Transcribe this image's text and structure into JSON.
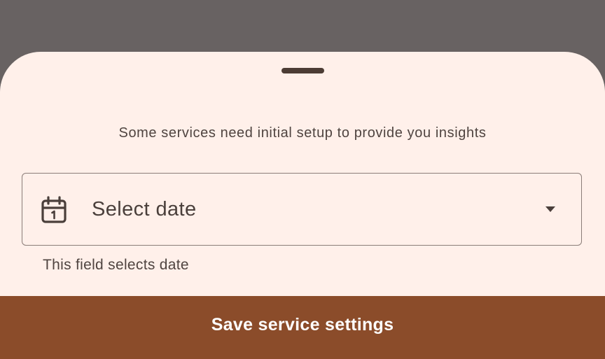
{
  "sheet": {
    "subtitle": "Some services need initial setup to provide you insights",
    "date_field": {
      "icon": "calendar-icon",
      "value": "Select date",
      "trailing_icon": "dropdown-arrow-icon",
      "helper_text": "This field selects date"
    },
    "save_button_label": "Save service settings"
  },
  "colors": {
    "scrim": "#686262",
    "sheet_background": "#fff0ea",
    "accent": "#8b4c2a",
    "text": "#4f4440",
    "outline": "#8a7d78"
  }
}
